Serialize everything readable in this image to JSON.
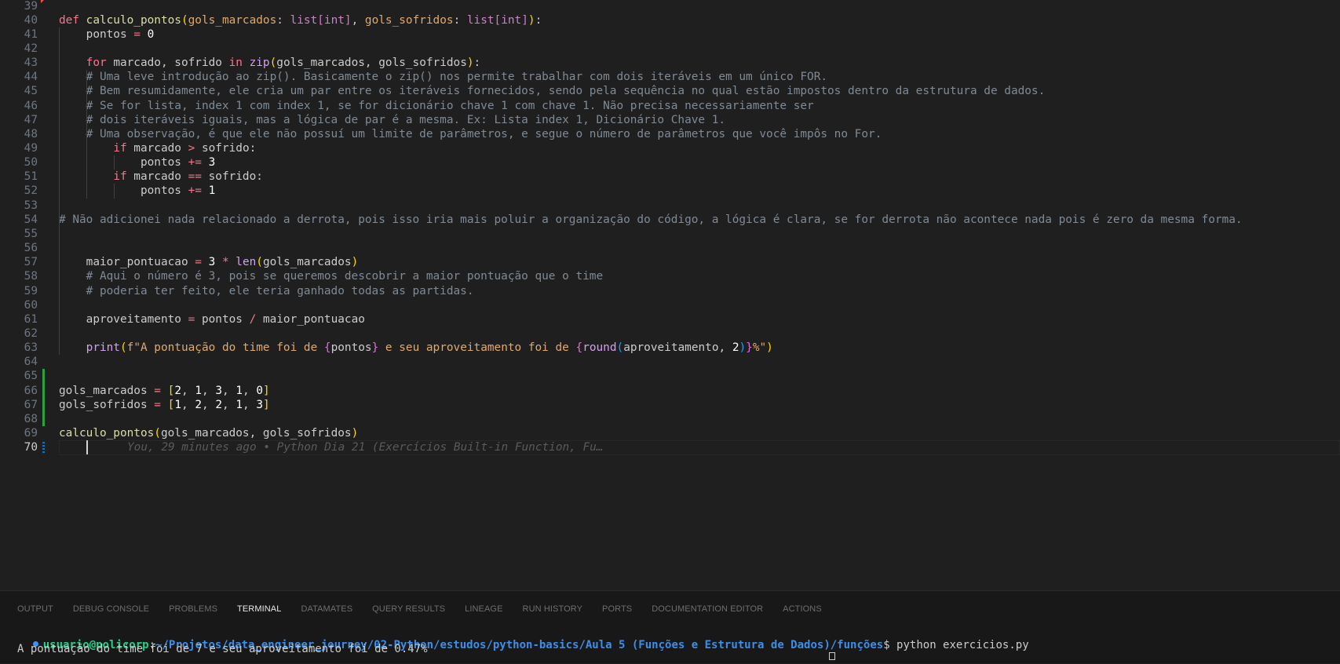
{
  "editor": {
    "lines": [
      {
        "n": "39",
        "t": []
      },
      {
        "n": "40",
        "t": [
          [
            "kw2",
            "def "
          ],
          [
            "fn",
            "calculo_pontos"
          ],
          [
            "brk1",
            "("
          ],
          [
            "param",
            "gols_marcados"
          ],
          [
            "var",
            ": "
          ],
          [
            "type",
            "list"
          ],
          [
            "brk2",
            "["
          ],
          [
            "type",
            "int"
          ],
          [
            "brk2",
            "]"
          ],
          [
            "var",
            ", "
          ],
          [
            "param",
            "gols_sofridos"
          ],
          [
            "var",
            ": "
          ],
          [
            "type",
            "list"
          ],
          [
            "brk2",
            "["
          ],
          [
            "type",
            "int"
          ],
          [
            "brk2",
            "]"
          ],
          [
            "brk1",
            ")"
          ],
          [
            "var",
            ":"
          ]
        ]
      },
      {
        "n": "41",
        "t": [
          [
            "var",
            "    pontos "
          ],
          [
            "op",
            "="
          ],
          [
            "num",
            " 0"
          ]
        ]
      },
      {
        "n": "42",
        "t": []
      },
      {
        "n": "43",
        "t": [
          [
            "var",
            "    "
          ],
          [
            "kw2",
            "for"
          ],
          [
            "var",
            " marcado, sofrido "
          ],
          [
            "kw2",
            "in"
          ],
          [
            "var",
            " "
          ],
          [
            "fnp",
            "zip"
          ],
          [
            "brk1",
            "("
          ],
          [
            "var",
            "gols_marcados, gols_sofridos"
          ],
          [
            "brk1",
            ")"
          ],
          [
            "var",
            ":"
          ]
        ]
      },
      {
        "n": "44",
        "t": [
          [
            "cmt",
            "    # Uma leve introdução ao zip(). Basicamente o zip() nos permite trabalhar com dois iteráveis em um único FOR."
          ]
        ]
      },
      {
        "n": "45",
        "t": [
          [
            "cmt",
            "    # Bem resumidamente, ele cria um par entre os iteráveis fornecidos, sendo pela sequência no qual estão impostos dentro da estrutura de dados."
          ]
        ]
      },
      {
        "n": "46",
        "t": [
          [
            "cmt",
            "    # Se for lista, index 1 com index 1, se for dicionário chave 1 com chave 1. Não precisa necessariamente ser"
          ]
        ]
      },
      {
        "n": "47",
        "t": [
          [
            "cmt",
            "    # dois iteráveis iguais, mas a lógica de par é a mesma. Ex: Lista index 1, Dicionário Chave 1."
          ]
        ]
      },
      {
        "n": "48",
        "t": [
          [
            "cmt",
            "    # Uma observação, é que ele não possuí um limite de parâmetros, e segue o número de parâmetros que você impôs no For."
          ]
        ]
      },
      {
        "n": "49",
        "t": [
          [
            "var",
            "        "
          ],
          [
            "kw2",
            "if"
          ],
          [
            "var",
            " marcado "
          ],
          [
            "op",
            ">"
          ],
          [
            "var",
            " sofrido:"
          ]
        ]
      },
      {
        "n": "50",
        "t": [
          [
            "var",
            "            pontos "
          ],
          [
            "op",
            "+="
          ],
          [
            "num",
            " 3"
          ]
        ]
      },
      {
        "n": "51",
        "t": [
          [
            "var",
            "        "
          ],
          [
            "kw2",
            "if"
          ],
          [
            "var",
            " marcado "
          ],
          [
            "op",
            "=="
          ],
          [
            "var",
            " sofrido:"
          ]
        ]
      },
      {
        "n": "52",
        "t": [
          [
            "var",
            "            pontos "
          ],
          [
            "op",
            "+="
          ],
          [
            "num",
            " 1"
          ]
        ]
      },
      {
        "n": "53",
        "t": []
      },
      {
        "n": "54",
        "t": [
          [
            "cmt",
            "# Não adicionei nada relacionado a derrota, pois isso iria mais poluir a organização do código, a lógica é clara, se for derrota não acontece nada pois é zero da mesma forma."
          ]
        ]
      },
      {
        "n": "55",
        "t": []
      },
      {
        "n": "56",
        "t": []
      },
      {
        "n": "57",
        "t": [
          [
            "var",
            "    maior_pontuacao "
          ],
          [
            "op",
            "="
          ],
          [
            "num",
            " 3"
          ],
          [
            "op",
            " *"
          ],
          [
            "var",
            " "
          ],
          [
            "fnp",
            "len"
          ],
          [
            "brk1",
            "("
          ],
          [
            "var",
            "gols_marcados"
          ],
          [
            "brk1",
            ")"
          ]
        ]
      },
      {
        "n": "58",
        "t": [
          [
            "cmt",
            "    # Aqui o número é 3, pois se queremos descobrir a maior pontuação que o time"
          ]
        ]
      },
      {
        "n": "59",
        "t": [
          [
            "cmt",
            "    # poderia ter feito, ele teria ganhado todas as partidas."
          ]
        ]
      },
      {
        "n": "60",
        "t": []
      },
      {
        "n": "61",
        "t": [
          [
            "var",
            "    aproveitamento "
          ],
          [
            "op",
            "="
          ],
          [
            "var",
            " pontos "
          ],
          [
            "op",
            "/"
          ],
          [
            "var",
            " maior_pontuacao"
          ]
        ]
      },
      {
        "n": "62",
        "t": []
      },
      {
        "n": "63",
        "t": [
          [
            "var",
            "    "
          ],
          [
            "fnp",
            "print"
          ],
          [
            "brk1",
            "("
          ],
          [
            "str",
            "f\"A pontuação do time foi de "
          ],
          [
            "brk2",
            "{"
          ],
          [
            "var",
            "pontos"
          ],
          [
            "brk2",
            "}"
          ],
          [
            "str",
            " e seu aproveitamento foi de "
          ],
          [
            "brk2",
            "{"
          ],
          [
            "fnp",
            "round"
          ],
          [
            "brk3",
            "("
          ],
          [
            "var",
            "aproveitamento, "
          ],
          [
            "num",
            "2"
          ],
          [
            "brk3",
            ")"
          ],
          [
            "brk2",
            "}"
          ],
          [
            "str",
            "%\""
          ],
          [
            "brk1",
            ")"
          ]
        ]
      },
      {
        "n": "64",
        "t": []
      },
      {
        "n": "65",
        "t": []
      },
      {
        "n": "66",
        "t": [
          [
            "var",
            "gols_marcados "
          ],
          [
            "op",
            "="
          ],
          [
            "var",
            " "
          ],
          [
            "brk1",
            "["
          ],
          [
            "num",
            "2"
          ],
          [
            "var",
            ", "
          ],
          [
            "num",
            "1"
          ],
          [
            "var",
            ", "
          ],
          [
            "num",
            "3"
          ],
          [
            "var",
            ", "
          ],
          [
            "num",
            "1"
          ],
          [
            "var",
            ", "
          ],
          [
            "num",
            "0"
          ],
          [
            "brk1",
            "]"
          ]
        ]
      },
      {
        "n": "67",
        "t": [
          [
            "var",
            "gols_sofridos "
          ],
          [
            "op",
            "="
          ],
          [
            "var",
            " "
          ],
          [
            "brk1",
            "["
          ],
          [
            "num",
            "1"
          ],
          [
            "var",
            ", "
          ],
          [
            "num",
            "2"
          ],
          [
            "var",
            ", "
          ],
          [
            "num",
            "2"
          ],
          [
            "var",
            ", "
          ],
          [
            "num",
            "1"
          ],
          [
            "var",
            ", "
          ],
          [
            "num",
            "3"
          ],
          [
            "brk1",
            "]"
          ]
        ]
      },
      {
        "n": "68",
        "t": []
      },
      {
        "n": "69",
        "t": [
          [
            "fn",
            "calculo_pontos"
          ],
          [
            "brk1",
            "("
          ],
          [
            "var",
            "gols_marcados, gols_sofridos"
          ],
          [
            "brk1",
            ")"
          ]
        ]
      },
      {
        "n": "70",
        "t": []
      }
    ],
    "active_line": "70",
    "blame": "You, 29 minutes ago • Python Dia 21 (Exercícios Built-in Function, Fu…"
  },
  "panel": {
    "tabs": [
      {
        "label": "OUTPUT",
        "active": false
      },
      {
        "label": "DEBUG CONSOLE",
        "active": false
      },
      {
        "label": "PROBLEMS",
        "active": false
      },
      {
        "label": "TERMINAL",
        "active": true
      },
      {
        "label": "DATAMATES",
        "active": false
      },
      {
        "label": "QUERY RESULTS",
        "active": false
      },
      {
        "label": "LINEAGE",
        "active": false
      },
      {
        "label": "RUN HISTORY",
        "active": false
      },
      {
        "label": "PORTS",
        "active": false
      },
      {
        "label": "DOCUMENTATION EDITOR",
        "active": false
      },
      {
        "label": "ACTIONS",
        "active": false
      }
    ],
    "terminal": {
      "user": "usuario@policorp",
      "sep": ":",
      "path": "~/Projetos/data_engineer_journey/02-Python/estudos/python-basics/Aula 5 (Funções e Estrutura de Dados)/funções",
      "command": "$ python exercicios.py",
      "output": "A pontuação do time foi de 7 e seu aproveitamento foi de 0.47%"
    }
  },
  "colors": {
    "editor_bg": "#1f1f1f",
    "panel_bg": "#181818",
    "git_added": "#2ea043",
    "git_modified": "#0078d4",
    "prompt_user": "#23d18b",
    "prompt_path": "#3b8eea"
  }
}
